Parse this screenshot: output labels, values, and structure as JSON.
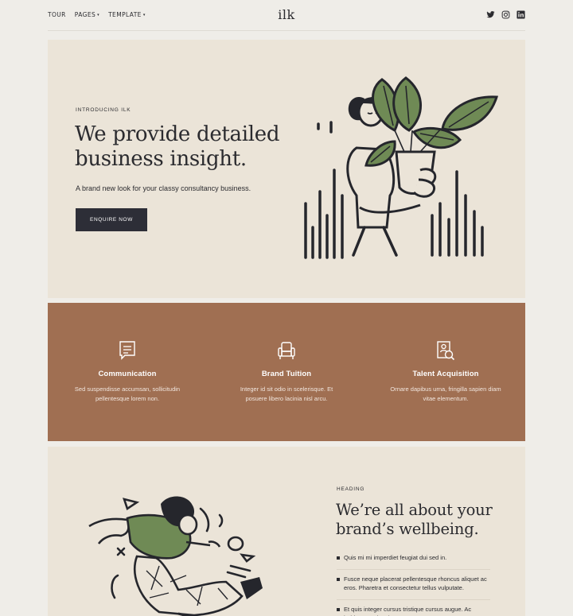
{
  "nav": {
    "items": [
      {
        "label": "TOUR",
        "dropdown": false
      },
      {
        "label": "PAGES",
        "dropdown": true
      },
      {
        "label": "TEMPLATE",
        "dropdown": true
      }
    ],
    "caret": "▾"
  },
  "brand": {
    "logo": "ilk"
  },
  "social": {
    "icons": [
      "twitter-icon",
      "instagram-icon",
      "linkedin-icon"
    ]
  },
  "hero": {
    "eyebrow": "INTRODUCING ILK",
    "title": "We provide detailed business insight.",
    "subtitle": "A brand new look for your classy consultancy business.",
    "cta_label": "ENQUIRE NOW"
  },
  "features": [
    {
      "icon": "message-icon",
      "title": "Communication",
      "text": "Sed suspendisse accumsan, sollicitudin pellentesque lorem non."
    },
    {
      "icon": "chair-icon",
      "title": "Brand Tuition",
      "text": "Integer id sit odio in scelerisque. Et posuere libero lacinia nisl arcu."
    },
    {
      "icon": "profile-search-icon",
      "title": "Talent Acquisition",
      "text": "Ornare dapibus urna, fringilla sapien diam vitae elementum."
    }
  ],
  "about": {
    "eyebrow": "HEADING",
    "title": "We’re all about your brand’s wellbeing.",
    "list": [
      "Quis mi mi imperdiet feugiat dui sed in.",
      "Fusce neque placerat pellentesque rhoncus aliquet ac eros. Pharetra et consectetur tellus vulputate.",
      "Et quis integer cursus tristique cursus augue. Ac habitant pretium in."
    ]
  },
  "colors": {
    "background": "#efede8",
    "panel": "#ebe4d8",
    "features_bg": "#a06f52",
    "dark": "#2d2e37",
    "leaf_green": "#6f8a55"
  }
}
